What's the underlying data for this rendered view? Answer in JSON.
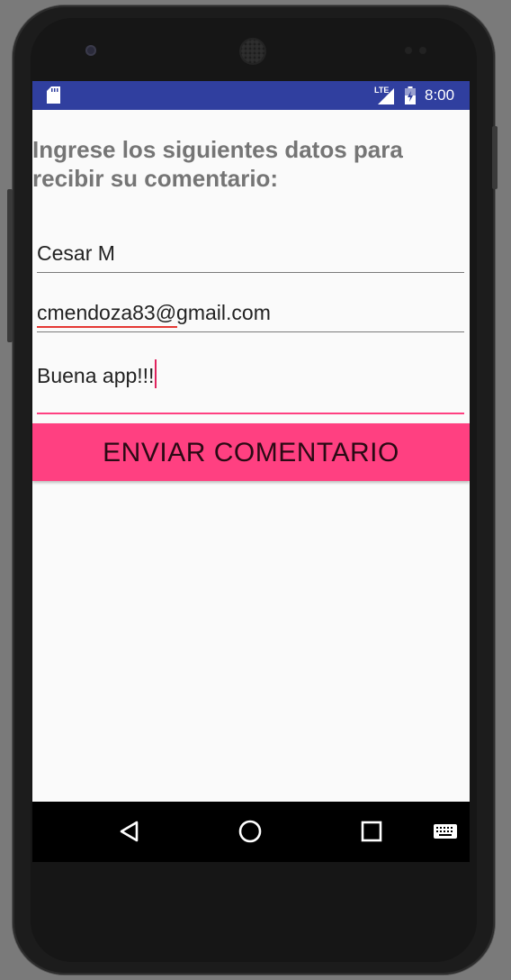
{
  "status_bar": {
    "network_label": "LTE",
    "time": "8:00",
    "icons": [
      "sd-card-icon",
      "signal-icon",
      "battery-icon"
    ]
  },
  "form": {
    "heading": "Ingrese los siguientes datos para recibir su comentario:",
    "name_value": "Cesar M",
    "email_value": "cmendoza83@gmail.com",
    "comment_value": "Buena app!!!",
    "submit_label": "ENVIAR COMENTARIO"
  },
  "nav_bar": {
    "buttons": [
      "back-icon",
      "home-icon",
      "recents-icon",
      "keyboard-icon"
    ]
  },
  "colors": {
    "status_bar": "#303f9f",
    "accent": "#ff4081",
    "background": "#fafafa",
    "heading_text": "#757575"
  }
}
